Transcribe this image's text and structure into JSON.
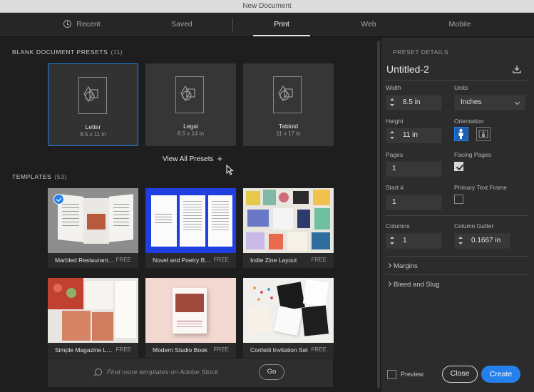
{
  "window": {
    "title": "New Document"
  },
  "tabs": [
    {
      "label": "Recent",
      "icon": "clock-icon"
    },
    {
      "label": "Saved"
    },
    {
      "label": "Print",
      "active": true
    },
    {
      "label": "Web"
    },
    {
      "label": "Mobile"
    }
  ],
  "presets": {
    "title": "BLANK DOCUMENT PRESETS",
    "count": "(11)",
    "items": [
      {
        "name": "Letter",
        "size": "8.5 x 11 in",
        "selected": true
      },
      {
        "name": "Legal",
        "size": "8.5 x 14 in"
      },
      {
        "name": "Tabloid",
        "size": "11 x 17 in"
      }
    ],
    "view_all": "View All Presets",
    "view_all_icon": "plus-icon"
  },
  "templates": {
    "title": "TEMPLATES",
    "count": "(53)",
    "items": [
      {
        "name": "Marbled Restaurant Menu",
        "badge": "FREE",
        "selected": true
      },
      {
        "name": "Novel and Poetry Book",
        "badge": "FREE"
      },
      {
        "name": "Indie Zine Layout",
        "badge": "FREE"
      },
      {
        "name": "Simple Magazine Layout",
        "badge": "FREE"
      },
      {
        "name": "Modern Studio Book",
        "badge": "FREE"
      },
      {
        "name": "Confetti Invitation Set",
        "badge": "FREE"
      }
    ],
    "search_placeholder": "Find more templates on Adobe Stock",
    "go_label": "Go"
  },
  "details": {
    "title": "PRESET DETAILS",
    "doc_name": "Untitled-2",
    "width_label": "Width",
    "width_value": "8.5 in",
    "units_label": "Units",
    "units_value": "Inches",
    "height_label": "Height",
    "height_value": "11 in",
    "orientation_label": "Orientation",
    "orientation": "portrait",
    "pages_label": "Pages",
    "pages_value": "1",
    "facing_label": "Facing Pages",
    "facing_checked": true,
    "start_label": "Start #",
    "start_value": "1",
    "primary_label": "Primary Text Frame",
    "primary_checked": false,
    "columns_label": "Columns",
    "columns_value": "1",
    "gutter_label": "Column Gutter",
    "gutter_value": "0.1667 in",
    "margins_label": "Margins",
    "bleed_label": "Bleed and Slug",
    "preview_label": "Preview",
    "close_label": "Close",
    "create_label": "Create"
  },
  "colors": {
    "accent": "#2680eb",
    "panel": "#2c2c2c",
    "background": "#1e1e1e"
  }
}
